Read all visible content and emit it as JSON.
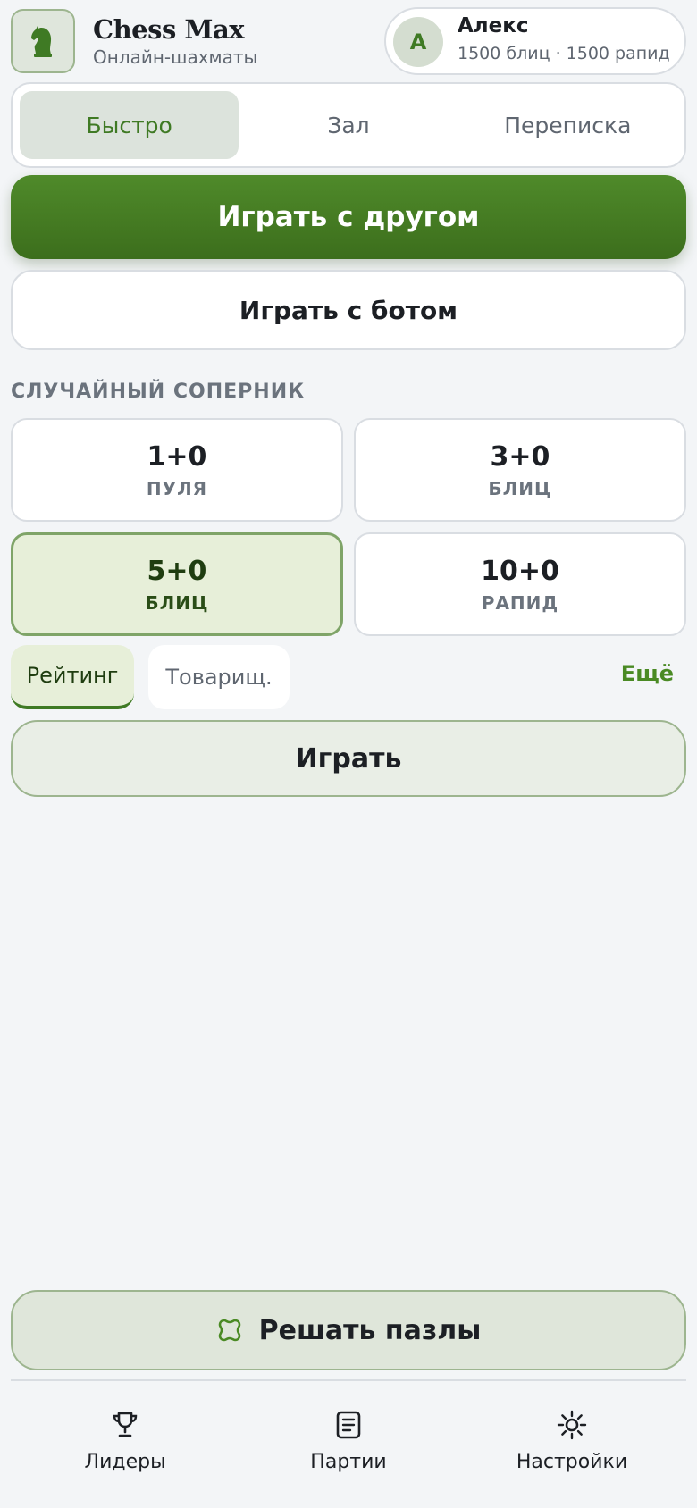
{
  "app": {
    "title": "Chess Max",
    "subtitle": "Онлайн-шахматы",
    "logo_icon": "knight-icon"
  },
  "profile": {
    "initial": "А",
    "name": "Алекс",
    "ratings": "1500 блиц · 1500 рапид"
  },
  "tabs": [
    {
      "label": "Быстро",
      "active": true
    },
    {
      "label": "Зал",
      "active": false
    },
    {
      "label": "Переписка",
      "active": false
    }
  ],
  "actions": {
    "play_friend": "Играть с другом",
    "play_bot": "Играть с ботом"
  },
  "random_opponent": {
    "section_title": "СЛУЧАЙНЫЙ СОПЕРНИК",
    "time_controls": [
      {
        "time": "1+0",
        "kind": "ПУЛЯ",
        "selected": false
      },
      {
        "time": "3+0",
        "kind": "БЛИЦ",
        "selected": false
      },
      {
        "time": "5+0",
        "kind": "БЛИЦ",
        "selected": true
      },
      {
        "time": "10+0",
        "kind": "РАПИД",
        "selected": false
      }
    ],
    "modes": [
      {
        "label": "Рейтинг",
        "active": true
      },
      {
        "label": "Товарищ.",
        "active": false
      }
    ],
    "more_label": "Ещё",
    "play_label": "Играть"
  },
  "puzzles": {
    "label": "Решать пазлы",
    "icon": "puzzle-icon"
  },
  "bottom_nav": [
    {
      "label": "Лидеры",
      "icon": "trophy-icon"
    },
    {
      "label": "Партии",
      "icon": "document-icon"
    },
    {
      "label": "Настройки",
      "icon": "sun-icon"
    }
  ],
  "colors": {
    "accent": "#3f7a24",
    "selected_bg": "#e7efd9",
    "background": "#f3f5f7"
  }
}
